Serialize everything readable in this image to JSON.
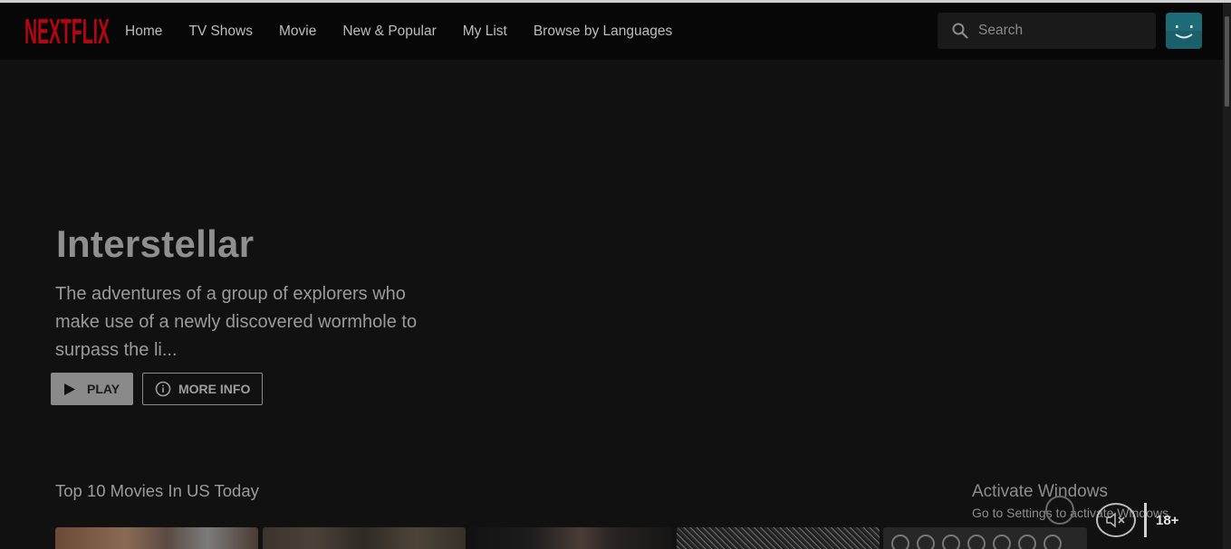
{
  "brand": {
    "logo_text": "NEXTFLIX",
    "color": "#b20710"
  },
  "nav": {
    "links": [
      {
        "label": "Home"
      },
      {
        "label": "TV Shows"
      },
      {
        "label": "Movie"
      },
      {
        "label": "New & Popular"
      },
      {
        "label": "My List"
      },
      {
        "label": "Browse by Languages"
      }
    ]
  },
  "search": {
    "placeholder": "Search",
    "icon": "search-icon"
  },
  "profile": {
    "icon": "smiley-avatar-icon",
    "color": "#1f6f7a"
  },
  "hero": {
    "title": "Interstellar",
    "description": "The adventures of a group of explorers who make use of a newly discovered wormhole to surpass the li...",
    "play_label": "PLAY",
    "info_label": "MORE INFO"
  },
  "row": {
    "title": "Top 10 Movies In US Today",
    "items": [
      {
        "name": "movie-1"
      },
      {
        "name": "movie-2"
      },
      {
        "name": "movie-3"
      },
      {
        "name": "movie-4"
      },
      {
        "name": "movie-5"
      }
    ]
  },
  "preview": {
    "rating": "18+",
    "mute_icon": "volume-mute-icon"
  },
  "watermark": {
    "line1": "Activate Windows",
    "line2": "Go to Settings to activate Windows."
  }
}
